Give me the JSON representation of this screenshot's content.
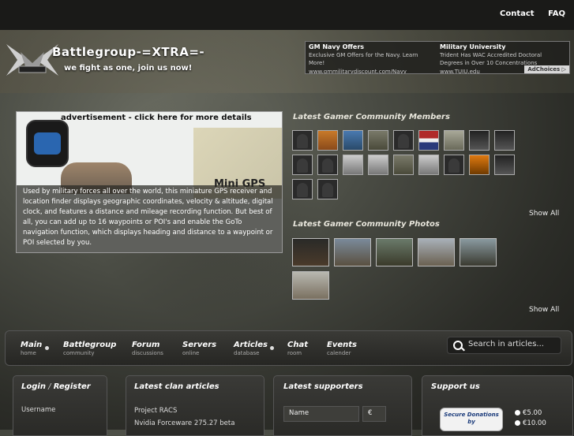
{
  "top_links": [
    "Contact",
    "FAQ"
  ],
  "header": {
    "title": "Battlegroup-=XTRA=-",
    "tagline": "we fight as one, join us now!"
  },
  "ad_banner": {
    "col1": {
      "heading": "GM Navy Offers",
      "text": "Exclusive GM Offers for the Navy. Learn More!",
      "url": "www.gmmilitarydiscount.com/Navy"
    },
    "col2": {
      "heading": "Military University",
      "text": "Trident Has WAC Accredited Doctoral Degrees in Over 10 Concentrations",
      "url": "www.TUIU.edu"
    },
    "adchoices": "AdChoices ▷"
  },
  "advertisement": {
    "title": "advertisement - click here for more details",
    "image_label": "Mini GPS",
    "text": "Used by military forces all over the world, this miniature GPS receiver and location finder displays geographic coordinates, velocity & altitude, digital clock, and features a distance and mileage recording function. But best of all, you can add up to 16 waypoints or POI's and enable the GoTo navigation function, which displays heading and distance to a waypoint or POI selected by you."
  },
  "members": {
    "title": "Latest Gamer Community Members",
    "show_all": "Show All"
  },
  "photos": {
    "title": "Latest Gamer Community Photos",
    "show_all": "Show All"
  },
  "nav": [
    {
      "label": "Main",
      "sub": "home"
    },
    {
      "label": "Battlegroup",
      "sub": "community"
    },
    {
      "label": "Forum",
      "sub": "discussions"
    },
    {
      "label": "Servers",
      "sub": "online"
    },
    {
      "label": "Articles",
      "sub": "database"
    },
    {
      "label": "Chat",
      "sub": "room"
    },
    {
      "label": "Events",
      "sub": "calender"
    }
  ],
  "search": {
    "placeholder": "Search in articles..."
  },
  "panels": {
    "login": {
      "title_a": "Login",
      "title_sep": " / ",
      "title_b": "Register",
      "username_label": "Username"
    },
    "articles": {
      "title": "Latest clan articles",
      "items": [
        "Project RACS",
        "Nvidia Forceware 275.27 beta"
      ]
    },
    "supporters": {
      "title": "Latest supporters",
      "col_name": "Name",
      "col_amount": "€"
    },
    "support": {
      "title": "Support us",
      "badge": "Secure Donations by",
      "options": [
        "€5.00",
        "€10.00"
      ]
    }
  }
}
